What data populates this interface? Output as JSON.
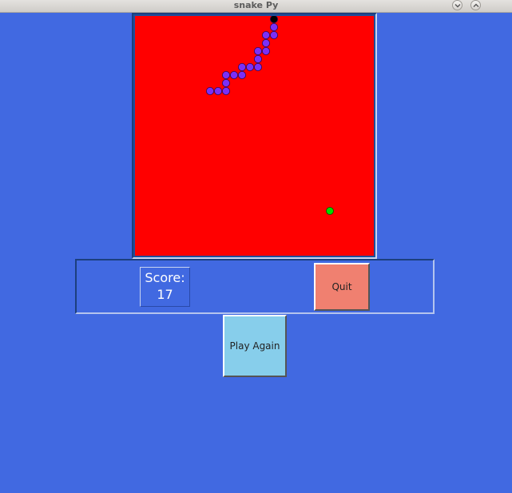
{
  "window": {
    "title": "snake Py"
  },
  "game": {
    "board_color": "#ff0000",
    "snake_color": "#7b2ff7",
    "snake_head_color": "#000000",
    "food_color": "#00dd00"
  },
  "score": {
    "label": "Score:",
    "value": "17"
  },
  "buttons": {
    "quit": "Quit",
    "play_again": "Play Again"
  },
  "colors": {
    "background": "#4169e1",
    "quit_button": "#f08070",
    "play_again_button": "#87ceeb"
  }
}
